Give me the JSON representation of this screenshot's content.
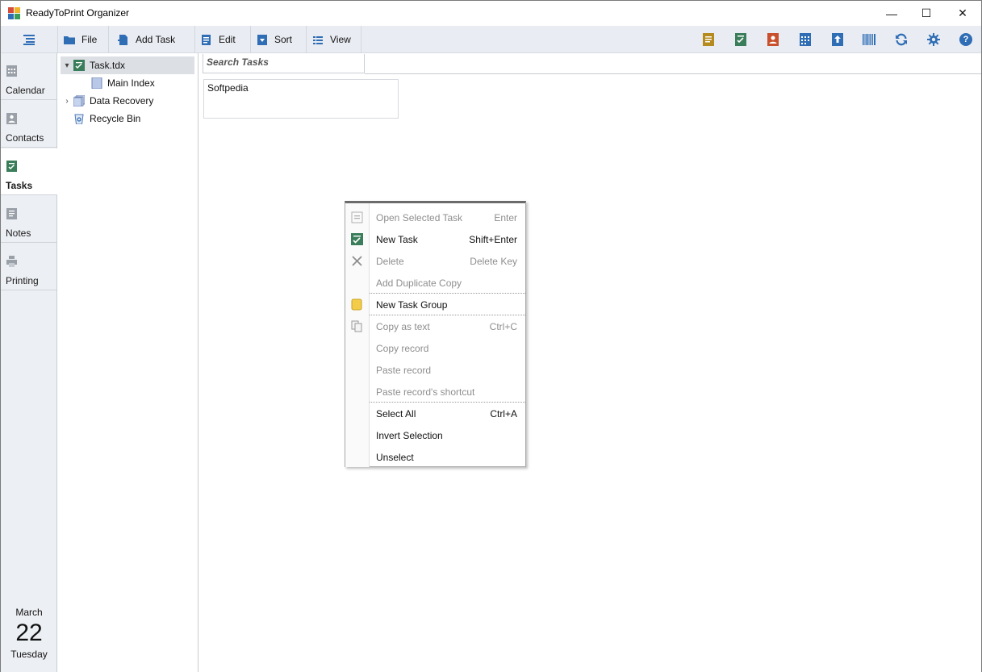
{
  "window": {
    "title": "ReadyToPrint Organizer",
    "controls": {
      "minimize": "—",
      "maximize": "☐",
      "close": "✕"
    }
  },
  "toolbar": {
    "menu_icon": "list-icon",
    "buttons": [
      {
        "label": "File",
        "icon": "folder-icon"
      },
      {
        "label": "Add Task",
        "icon": "add-document-icon"
      },
      {
        "label": "Edit",
        "icon": "edit-icon"
      },
      {
        "label": "Sort",
        "icon": "sort-icon"
      },
      {
        "label": "View",
        "icon": "view-list-icon"
      }
    ],
    "right_icons": [
      "notes-icon",
      "tasks-icon",
      "contacts-icon",
      "calendar-icon",
      "upload-icon",
      "barcode-icon",
      "sync-icon",
      "gear-icon",
      "help-icon"
    ],
    "help_glyph": "?"
  },
  "nav": {
    "items": [
      {
        "label": "Calendar",
        "icon": "calendar-icon"
      },
      {
        "label": "Contacts",
        "icon": "contacts-icon"
      },
      {
        "label": "Tasks",
        "icon": "tasks-icon",
        "active": true
      },
      {
        "label": "Notes",
        "icon": "notes-icon"
      },
      {
        "label": "Printing",
        "icon": "printer-icon"
      }
    ],
    "date": {
      "month": "March",
      "day": "22",
      "weekday": "Tuesday"
    }
  },
  "tree": {
    "items": [
      {
        "label": "Task.tdx",
        "icon": "tasks-file-icon",
        "expanded": true,
        "selected": true
      },
      {
        "label": "Main Index",
        "icon": "index-icon"
      },
      {
        "label": "Data Recovery",
        "icon": "recovery-icon",
        "collapsed": true
      },
      {
        "label": "Recycle Bin",
        "icon": "recycle-bin-icon"
      }
    ],
    "expanded_glyph": "▾",
    "collapsed_glyph": "›"
  },
  "main": {
    "search_placeholder": "Search Tasks",
    "task_card_text": "Softpedia"
  },
  "context_menu": {
    "items": [
      {
        "label": "Open Selected Task",
        "key": "Enter",
        "enabled": false
      },
      {
        "label": "New Task",
        "key": "Shift+Enter",
        "enabled": true
      },
      {
        "label": "Delete",
        "key": "Delete Key",
        "enabled": false
      },
      {
        "label": "Add Duplicate Copy",
        "key": "",
        "enabled": false
      },
      {
        "label": "New Task Group",
        "key": "",
        "enabled": true
      },
      {
        "label": "Copy as text",
        "key": "Ctrl+C",
        "enabled": false
      },
      {
        "label": "Copy record",
        "key": "",
        "enabled": false
      },
      {
        "label": "Paste record",
        "key": "",
        "enabled": false
      },
      {
        "label": "Paste record's shortcut",
        "key": "",
        "enabled": false
      },
      {
        "label": "Select All",
        "key": "Ctrl+A",
        "enabled": true
      },
      {
        "label": "Invert Selection",
        "key": "",
        "enabled": true
      },
      {
        "label": "Unselect",
        "key": "",
        "enabled": true
      }
    ]
  },
  "colors": {
    "toolbar_bg": "#e9edf3",
    "nav_bg": "#eceff3",
    "selection_bg": "#dcdfe4",
    "task_green": "#3a7d5a",
    "note_gold": "#b58a1e",
    "contact_red": "#c9502c",
    "accent_blue": "#2f6db5"
  }
}
